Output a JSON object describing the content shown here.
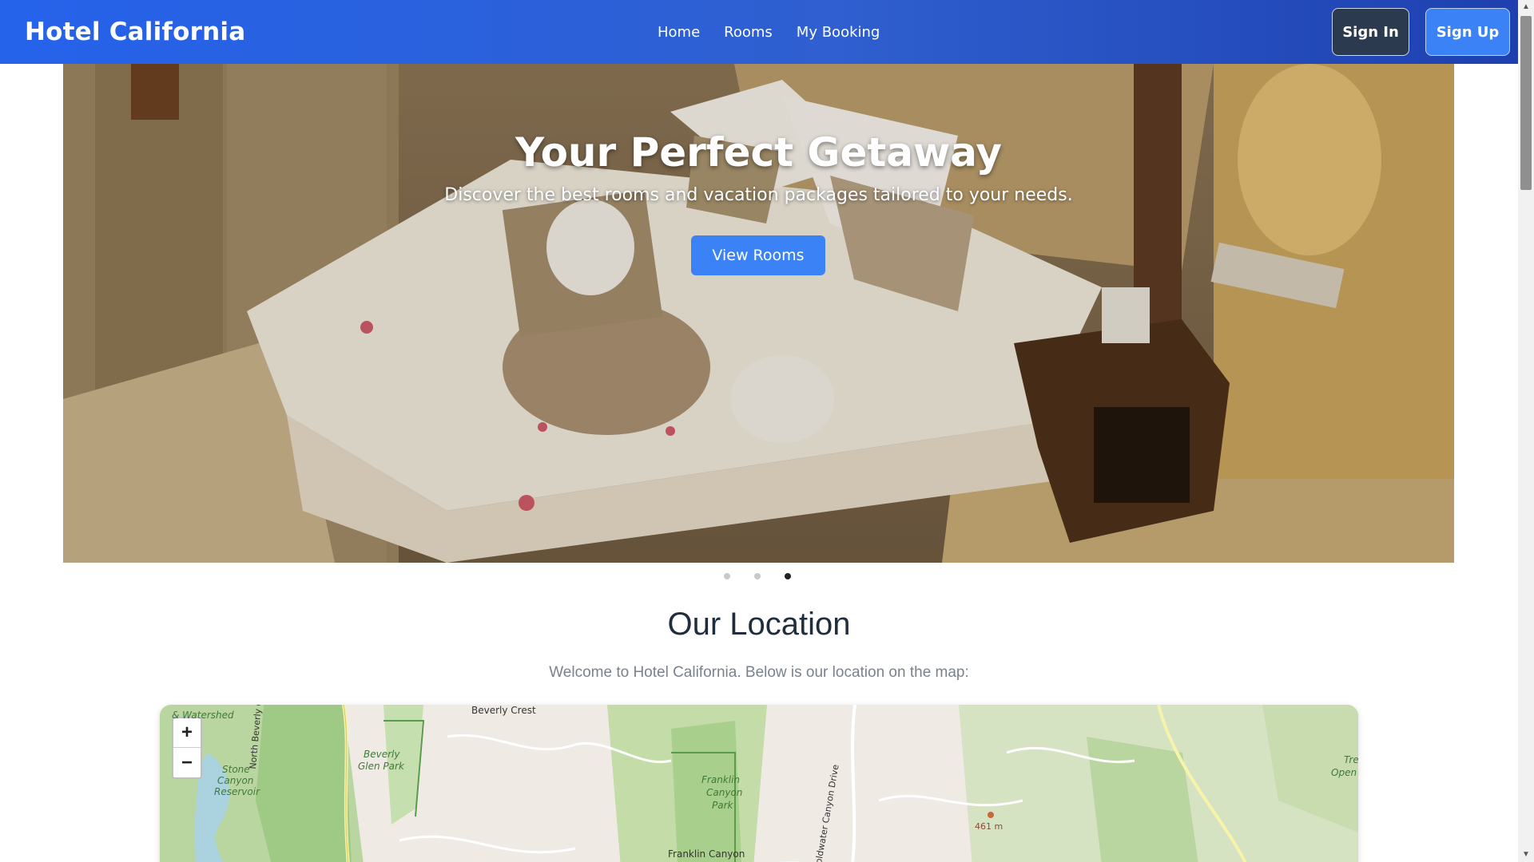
{
  "navbar": {
    "brand": "Hotel California",
    "links": [
      "Home",
      "Rooms",
      "My Booking"
    ],
    "sign_in": "Sign In",
    "sign_up": "Sign Up"
  },
  "hero": {
    "title": "Your Perfect Getaway",
    "subtitle": "Discover the best rooms and vacation packages tailored to your needs.",
    "button": "View Rooms",
    "slides_count": 3,
    "active_slide": 3
  },
  "location": {
    "title": "Our Location",
    "subtitle": "Welcome to Hotel California. Below is our location on the map:"
  },
  "map": {
    "zoom_in": "+",
    "zoom_out": "−",
    "labels": {
      "beverly_crest": "Beverly Crest",
      "watershed": "& Watershed",
      "beverly_glen_park_1": "Beverly",
      "beverly_glen_park_2": "Glen Park",
      "stone_canyon_1": "Stone",
      "stone_canyon_2": "Canyon",
      "stone_canyon_3": "Reservoir",
      "north_beverly": "North Beverly Glen Boulevard",
      "franklin_1": "Franklin",
      "franklin_2": "Canyon",
      "franklin_3": "Park",
      "franklin_canyon": "Franklin Canyon",
      "coldwater": "oldwater Canyon Drive",
      "elevation": "461 m",
      "tree_open_1": "Tre",
      "tree_open_2": "Open"
    }
  },
  "colors": {
    "nav_start": "#2563eb",
    "nav_end": "#1e40af",
    "accent": "#3b82f6",
    "sign_in_bg": "#2c3a4f",
    "title_text": "#1f2d3d"
  }
}
